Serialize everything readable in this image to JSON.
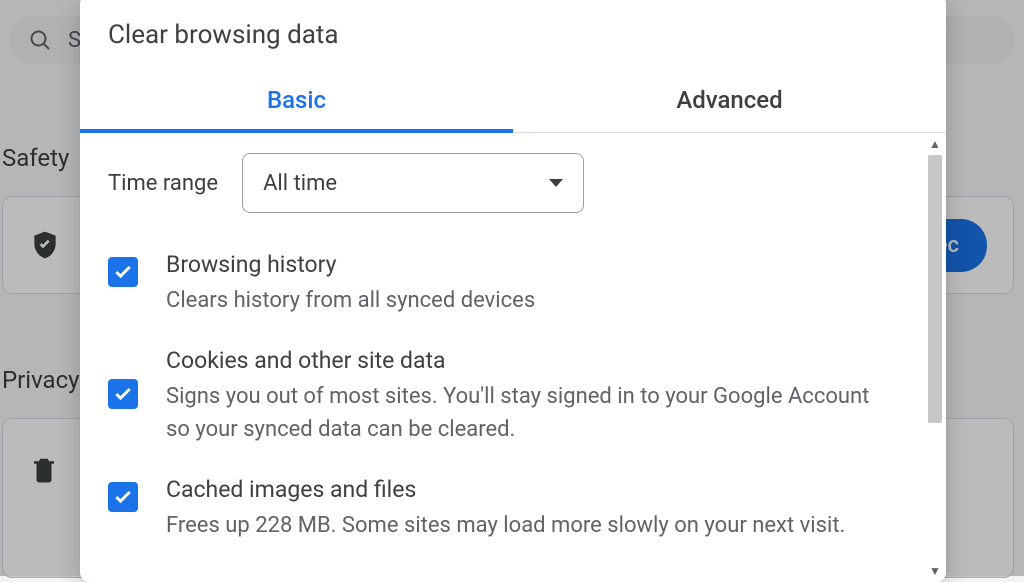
{
  "background": {
    "search_placeholder": "Se",
    "safety_heading": "Safety",
    "privacy_heading": "Privacy",
    "check_button": "Chec"
  },
  "dialog": {
    "title": "Clear browsing data",
    "tabs": {
      "basic": "Basic",
      "advanced": "Advanced"
    },
    "time_range": {
      "label": "Time range",
      "value": "All time"
    },
    "options": [
      {
        "title": "Browsing history",
        "desc": "Clears history from all synced devices"
      },
      {
        "title": "Cookies and other site data",
        "desc": "Signs you out of most sites. You'll stay signed in to your Google Account so your synced data can be cleared."
      },
      {
        "title": "Cached images and files",
        "desc": "Frees up 228 MB. Some sites may load more slowly on your next visit."
      }
    ]
  }
}
